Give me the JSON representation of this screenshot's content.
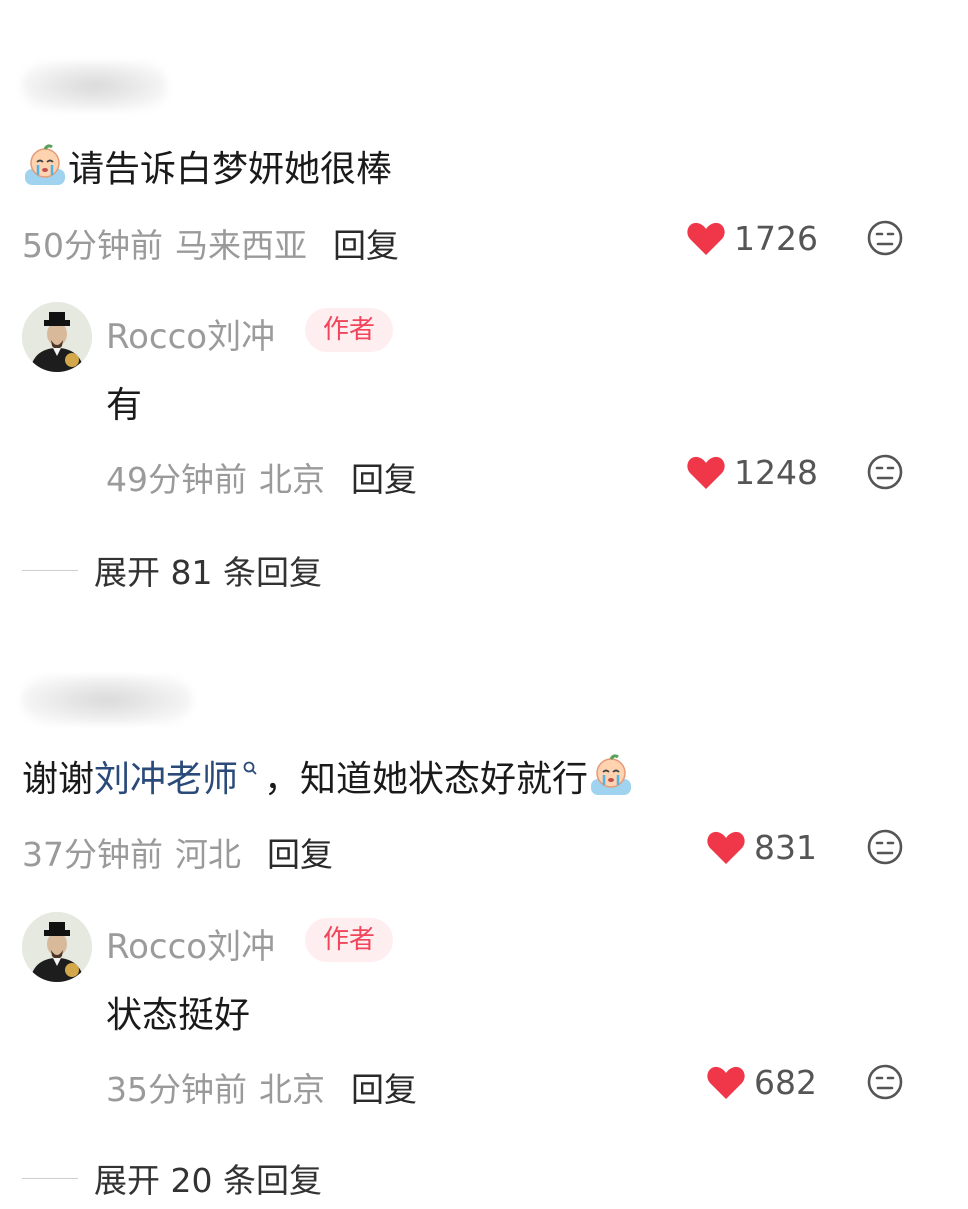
{
  "comments": [
    {
      "text": "请告诉白梦妍她很棒",
      "time": "50分钟前",
      "location": "马来西亚",
      "reply_label": "回复",
      "likes": "1726",
      "reply": {
        "author": "Rocco刘冲",
        "badge": "作者",
        "text": "有",
        "time": "49分钟前",
        "location": "北京",
        "reply_label": "回复",
        "likes": "1248"
      },
      "expand_label": "展开 81 条回复"
    },
    {
      "text_before": "谢谢 ",
      "link_text": "刘冲老师",
      "text_after": "，知道她状态好就行",
      "time": "37分钟前",
      "location": "河北",
      "reply_label": "回复",
      "likes": "831",
      "reply": {
        "author": "Rocco刘冲",
        "badge": "作者",
        "text": "状态挺好",
        "time": "35分钟前",
        "location": "北京",
        "reply_label": "回复",
        "likes": "682"
      },
      "expand_label": "展开 20 条回复"
    }
  ],
  "icons": {
    "like": "heart-icon",
    "dislike": "dislike-face-icon",
    "emoji": "crying-emoji-icon",
    "search_link": "search-icon"
  },
  "colors": {
    "heart": "#f0374a",
    "badge_bg": "#ffeef0",
    "badge_text": "#f0455a",
    "link": "#2a4a7a",
    "meta": "#9a9a9a"
  }
}
